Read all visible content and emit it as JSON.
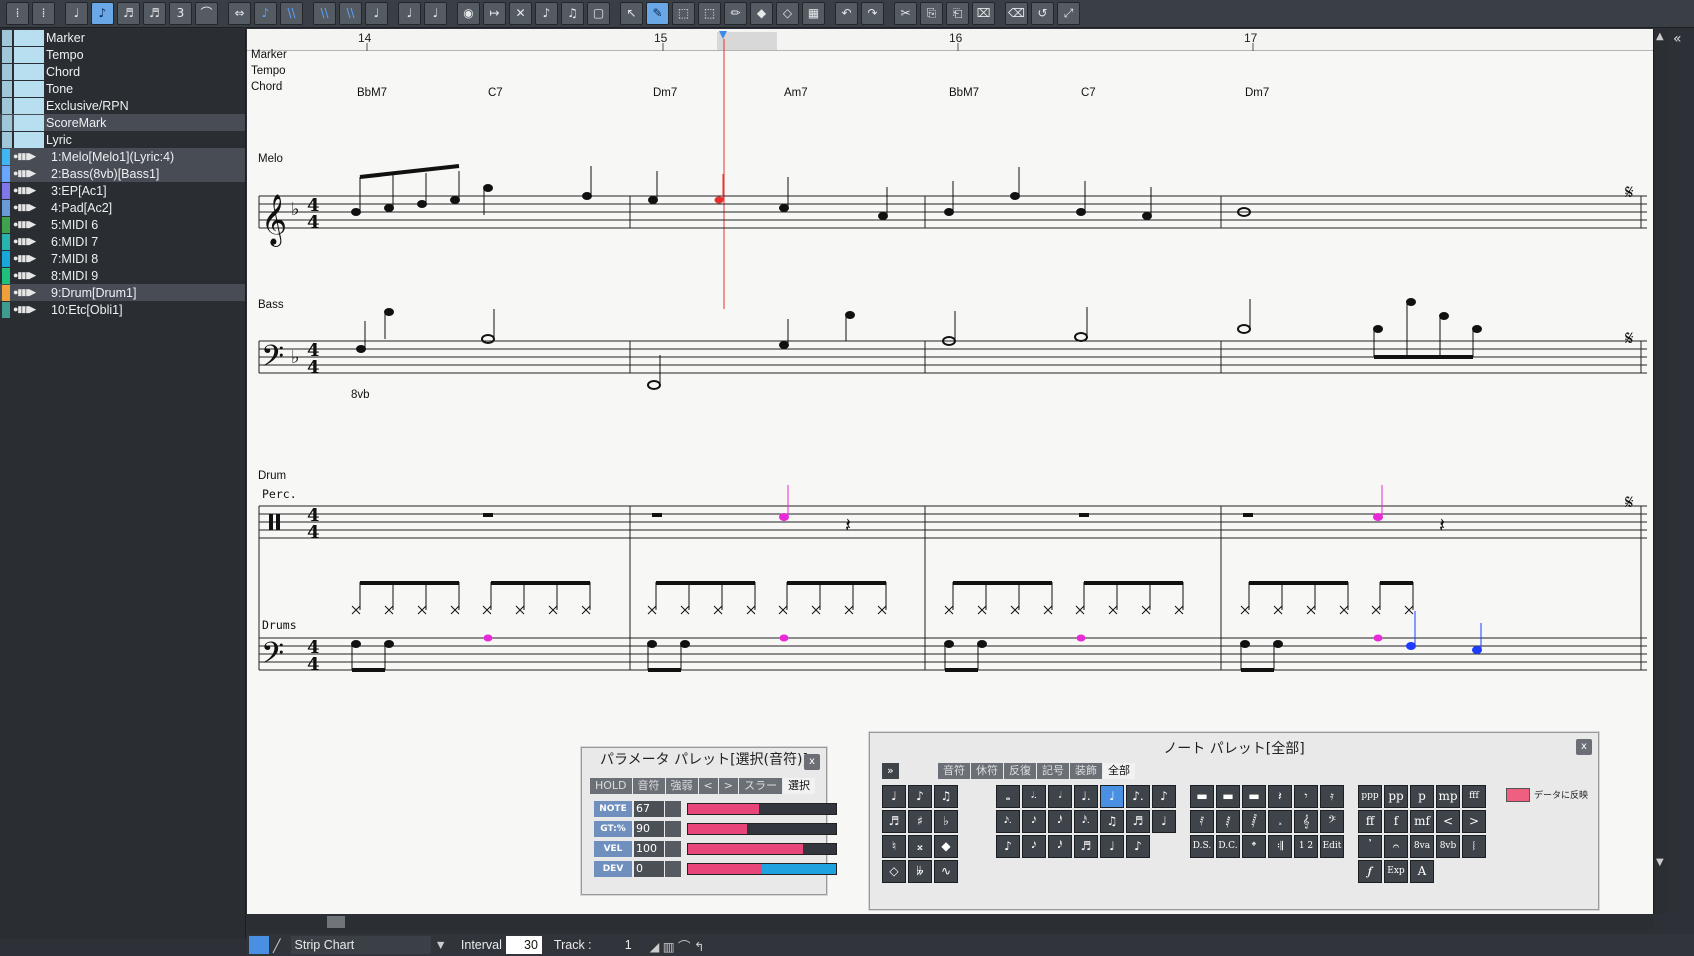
{
  "toolbar": {
    "buttons": [
      "grid",
      "snap",
      "quarter-note",
      "eighth-note",
      "sixteenth-note",
      "32nd-note",
      "triplet",
      "tie",
      "auto-beam",
      "slur",
      "beam-1",
      "beam-2",
      "beam-3",
      "stem-up",
      "stem-split",
      "stem-down",
      "marker",
      "goto",
      "cross",
      "grace",
      "cue",
      "frame",
      "select-arrow",
      "pen",
      "select-range",
      "cursor-range",
      "pencil",
      "fill",
      "erase",
      "stamp",
      "undo",
      "redo",
      "cut",
      "copy",
      "paste",
      "clear",
      "eraser",
      "tempo-curve",
      "fullscreen"
    ],
    "glyphs": [
      "⁞",
      "⁞",
      "♩",
      "♪",
      "♬",
      "♬",
      "3",
      "⌒",
      "⇔",
      "♪",
      "\\\\",
      "\\\\",
      "\\\\",
      "♩",
      "♩",
      "♩",
      "◉",
      "↦",
      "✕",
      "♪",
      "♫",
      "▢",
      "↖",
      "✎",
      "⬚",
      "⬚",
      "✏",
      "◆",
      "◇",
      "▦",
      "↶",
      "↷",
      "✂",
      "⎘",
      "⎗",
      "⌧",
      "⌫",
      "↺",
      "⤢"
    ]
  },
  "tracks": {
    "system": [
      {
        "label": "Marker"
      },
      {
        "label": "Tempo"
      },
      {
        "label": "Chord"
      },
      {
        "label": "Tone"
      },
      {
        "label": "Exclusive/RPN"
      },
      {
        "label": "ScoreMark"
      },
      {
        "label": "Lyric"
      }
    ],
    "items": [
      {
        "label": "1:Melo[Melo1](Lyric:4)",
        "color": "#3fb6f2",
        "highlight": true
      },
      {
        "label": "2:Bass(8vb)[Bass1]",
        "color": "#6aa6ff",
        "highlight": true
      },
      {
        "label": "3:EP[Ac1]",
        "color": "#7f78e8",
        "highlight": false
      },
      {
        "label": "4:Pad[Ac2]",
        "color": "#6a9ad8",
        "highlight": false
      },
      {
        "label": "5:MIDI 6",
        "color": "#3fa34d",
        "highlight": false
      },
      {
        "label": "6:MIDI 7",
        "color": "#29b3b0",
        "highlight": false
      },
      {
        "label": "7:MIDI 8",
        "color": "#19a6d8",
        "highlight": false
      },
      {
        "label": "8:MIDI 9",
        "color": "#21c07a",
        "highlight": false
      },
      {
        "label": "9:Drum[Drum1]",
        "color": "#f0a03a",
        "highlight": true
      },
      {
        "label": "10:Etc[Obli1]",
        "color": "#3d9c8f",
        "highlight": false
      }
    ]
  },
  "score": {
    "measures": [
      "14",
      "15",
      "16",
      "17"
    ],
    "system_labels": [
      "Marker",
      "Tempo",
      "Chord"
    ],
    "chords": [
      "BbM7",
      "C7",
      "Dm7",
      "Am7",
      "BbM7",
      "C7",
      "Dm7"
    ],
    "staff_labels": {
      "melo": "Melo",
      "bass": "Bass",
      "drum": "Drum",
      "perc": "Perc.",
      "drums": "Drums",
      "octave": "8vb"
    }
  },
  "param_palette": {
    "title": "パラメータ パレット[選択(音符)]",
    "tabs": [
      "HOLD",
      "音符",
      "強弱",
      "<",
      ">",
      "スラー",
      "選択"
    ],
    "rows": [
      {
        "label": "NOTE",
        "value": "67",
        "fill": 0.48
      },
      {
        "label": "GT:%",
        "value": "90",
        "fill": 0.4
      },
      {
        "label": "VEL",
        "value": "100",
        "fill": 0.78
      },
      {
        "label": "DEV",
        "value": "0",
        "fill": 0.5
      }
    ],
    "close": "x"
  },
  "note_palette": {
    "title": "ノート パレット[全部]",
    "expand": "»",
    "tabs": [
      "音符",
      "休符",
      "反復",
      "記号",
      "装飾",
      "全部"
    ],
    "reflect_label": "データに反映",
    "close": "x",
    "buttons_left": [
      "♩",
      "♪",
      "♫",
      "♬",
      "♯",
      "♭",
      "♮",
      "𝄪",
      "◆",
      "◇",
      "𝄫",
      "∿"
    ],
    "buttons_mid": [
      "𝅝",
      "𝅗𝅥.",
      "𝅗𝅥",
      "♩.",
      "♩",
      "♪.",
      "♪",
      "𝅘𝅥𝅯.",
      "𝅘𝅥𝅯",
      "𝅘𝅥𝅰",
      "𝅘𝅥𝅰.",
      "♫",
      "♬",
      "♩",
      "♪",
      "𝅘𝅥𝅯",
      "𝅘𝅥𝅰",
      "♬",
      "♩",
      "♪"
    ],
    "buttons_rest": [
      "▬",
      "▬",
      "▬",
      "𝄽",
      "𝄾",
      "𝄿",
      "𝅀",
      "𝅁",
      "𝅂",
      "𝅃",
      "𝄞",
      "𝄢",
      "D.S.",
      "D.C.",
      "𝄌",
      "𝄇",
      "1 2",
      "Edit"
    ],
    "buttons_dyn": [
      "ppp",
      "pp",
      "p",
      "mp",
      "fff",
      "ff",
      "f",
      "mf",
      "<",
      ">",
      "𝄒",
      "𝄐",
      "8va",
      "8vb",
      "𝆃",
      "𝆑",
      "Exp",
      "A"
    ]
  },
  "status": {
    "mode": "Strip Chart",
    "interval_label": "Interval",
    "interval_value": "30",
    "track_label": "Track :",
    "track_value": "1"
  },
  "colors": {
    "accent": "#4a90e2",
    "cursor": "#e83030",
    "select_note": "#e82ad8",
    "blue_note": "#1d3cff"
  }
}
